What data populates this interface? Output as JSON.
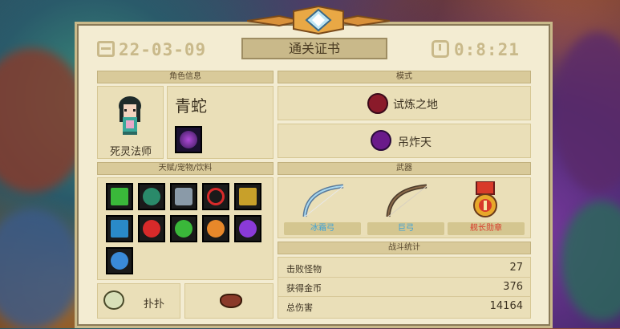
{
  "header": {
    "date": "22-03-09",
    "time": "0:8:21",
    "title": "通关证书"
  },
  "character": {
    "section_label": "角色信息",
    "name": "青蛇",
    "class": "死灵法师"
  },
  "mode": {
    "section_label": "模式",
    "items": [
      "试炼之地",
      "吊炸天"
    ]
  },
  "talents": {
    "section_label": "天赋/宠物/饮料",
    "icons": [
      "bow-skill-icon",
      "heart-shield-icon",
      "armor-icon",
      "crosshair-icon",
      "gun-icon",
      "target-icon",
      "health-icon",
      "green-shield-icon",
      "fire-shield-icon",
      "purple-shield-icon",
      "brain-icon"
    ]
  },
  "pet": {
    "name": "扑扑"
  },
  "weapons": {
    "section_label": "武器",
    "items": [
      {
        "name": "冰霜弓",
        "color": "#3aa0d8"
      },
      {
        "name": "巨弓",
        "color": "#3aa0d8"
      },
      {
        "name": "舰长勋章",
        "color": "#d83a2a"
      }
    ]
  },
  "stats": {
    "section_label": "战斗统计",
    "rows": [
      {
        "label": "击败怪物",
        "value": "27"
      },
      {
        "label": "获得金币",
        "value": "376"
      },
      {
        "label": "总伤害",
        "value": "14164"
      }
    ]
  }
}
